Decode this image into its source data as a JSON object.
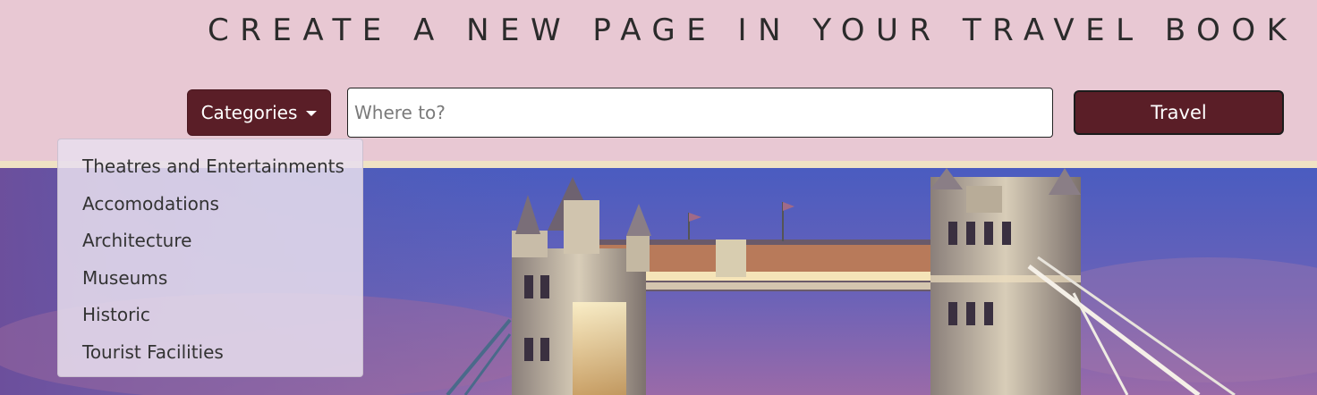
{
  "header": {
    "title": "CREATE A NEW PAGE IN YOUR TRAVEL BOOK"
  },
  "search_bar": {
    "categories_label": "Categories",
    "search_placeholder": "Where to?",
    "search_value": "",
    "travel_label": "Travel"
  },
  "dropdown": {
    "items": [
      {
        "label": "Theatres and Entertainments"
      },
      {
        "label": "Accomodations"
      },
      {
        "label": "Architecture"
      },
      {
        "label": "Museums"
      },
      {
        "label": "Historic"
      },
      {
        "label": "Tourist Facilities"
      }
    ]
  },
  "colors": {
    "header_bg": "#e8c8d3",
    "button_bg": "#5a1e27",
    "strip": "#efe2c4",
    "sky_top": "#4f5fb8",
    "sky_bottom": "#7a5aa8"
  },
  "hero": {
    "image_subject": "Tower Bridge at dusk"
  }
}
